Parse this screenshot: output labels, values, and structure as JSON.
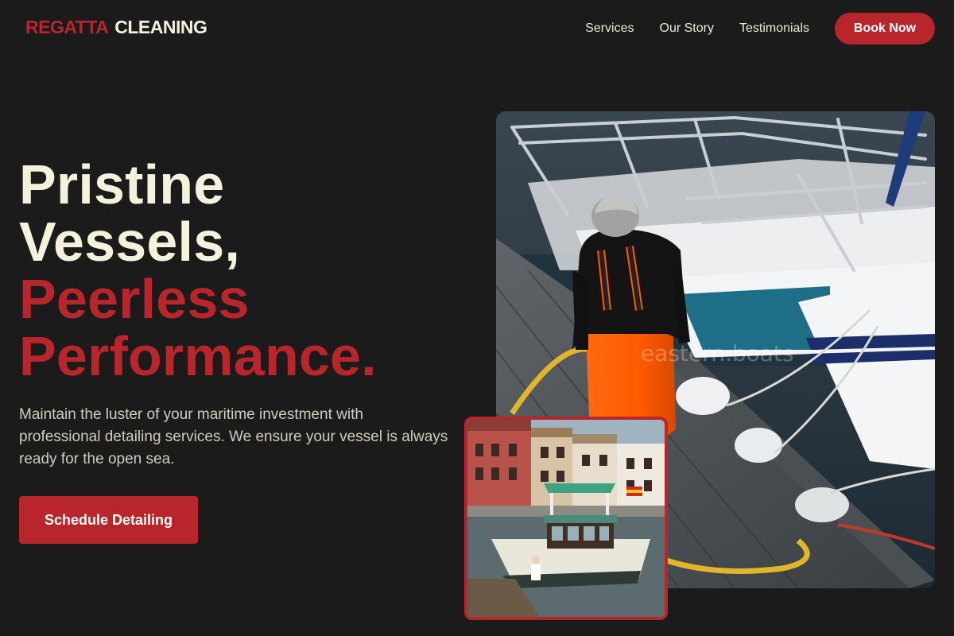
{
  "brand": {
    "part1": "REGATTA",
    "part2": "CLEANING"
  },
  "nav": {
    "links": [
      "Services",
      "Our Story",
      "Testimonials"
    ],
    "cta": "Book Now"
  },
  "hero": {
    "title_line1": "Pristine",
    "title_line2": "Vessels,",
    "title_line3": "Peerless",
    "title_line4": "Performance.",
    "subtitle": "Maintain the luster of your maritime investment with professional detailing services. We ensure your vessel is always ready for the open sea.",
    "cta": "Schedule Detailing"
  },
  "main_image": {
    "watermark": "eastern.boats"
  },
  "colors": {
    "background": "#1b1b1b",
    "accent": "#b8262b",
    "text": "#f4f1dc"
  }
}
